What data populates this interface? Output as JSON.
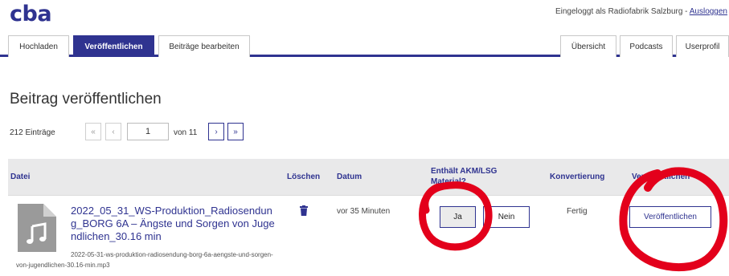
{
  "brand": {
    "logo": "cba",
    "color": "#2f3390"
  },
  "header": {
    "login_text": "Eingeloggt als Radiofabrik Salzburg - ",
    "logout_label": "Ausloggen"
  },
  "tabs_left": [
    {
      "label": "Hochladen",
      "active": false
    },
    {
      "label": "Veröffentlichen",
      "active": true
    },
    {
      "label": "Beiträge bearbeiten",
      "active": false
    }
  ],
  "tabs_right": [
    {
      "label": "Übersicht"
    },
    {
      "label": "Podcasts"
    },
    {
      "label": "Userprofil"
    }
  ],
  "page": {
    "title": "Beitrag veröffentlichen"
  },
  "pager": {
    "entries": "212 Einträge",
    "first": "«",
    "prev": "‹",
    "current_page": "1",
    "of_label": "von 11",
    "next": "›",
    "last": "»"
  },
  "table": {
    "columns": {
      "file": "Datei",
      "delete": "Löschen",
      "date": "Datum",
      "akm": "Enthält AKM/LSG Material?",
      "conversion": "Konvertierung",
      "publish": "Veröffentlichen"
    },
    "rows": [
      {
        "title": "2022_05_31_WS-Produktion_Radiosendung_BORG 6A – Ängste und Sorgen von Jugendlichen_30.16 min",
        "filename": "2022-05-31-ws-produktion-radiosendung-borg-6a-aengste-und-sorgen-von-jugendlichen-30.16-min.mp3",
        "date": "vor 35 Minuten",
        "akm_yes": "Ja",
        "akm_no": "Nein",
        "conversion": "Fertig",
        "publish_label": "Veröffentlichen"
      }
    ]
  },
  "annotation": {
    "color": "#e3001b"
  }
}
